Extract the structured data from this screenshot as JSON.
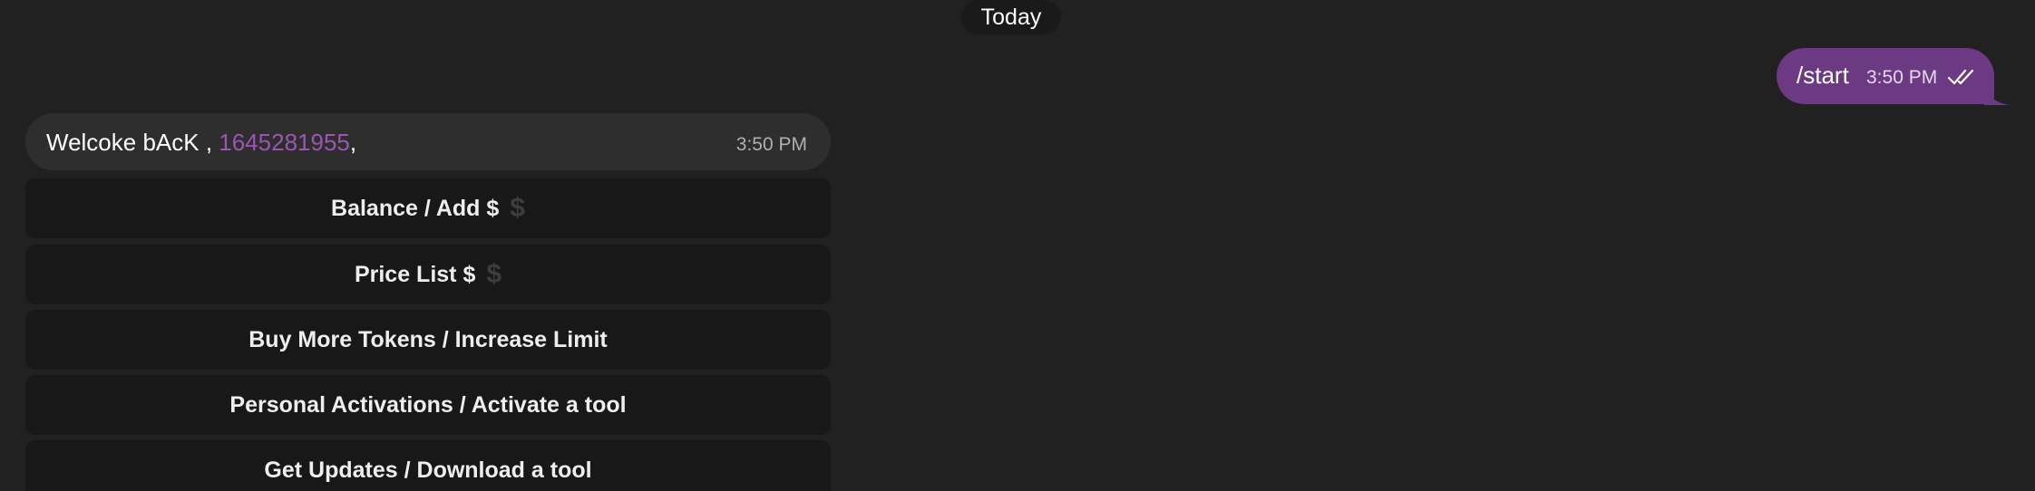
{
  "date_separator": "Today",
  "outgoing_message": {
    "text": "/start",
    "time": "3:50 PM",
    "status_icon": "double-check-icon",
    "bubble_color": "#6c3a82"
  },
  "incoming_message": {
    "text_prefix": "Welcoke bAcK , ",
    "user_id": "1645281955",
    "text_suffix": ",",
    "time": "3:50 PM",
    "user_id_color": "#9b55b3"
  },
  "keyboard": {
    "buttons": [
      {
        "label": "Balance / Add $",
        "icon": "dollar-icon",
        "icon_glyph": "$"
      },
      {
        "label": "Price List $",
        "icon": "dollar-icon",
        "icon_glyph": "$"
      },
      {
        "label": "Buy More Tokens / Increase Limit"
      },
      {
        "label": "Personal Activations / Activate a tool"
      },
      {
        "label": "Get Updates / Download a tool"
      }
    ]
  },
  "colors": {
    "background": "#212121",
    "incoming_bubble": "#2e2e2e",
    "keyboard_button": "#181818"
  }
}
